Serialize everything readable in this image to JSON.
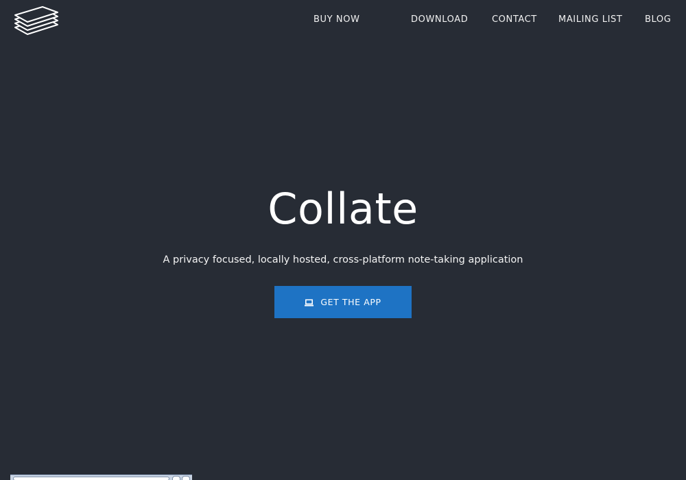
{
  "header": {
    "logo_icon": "stacked-papers-icon",
    "nav": [
      {
        "label": "BUY NOW"
      },
      {
        "label": "DOWNLOAD"
      },
      {
        "label": "CONTACT"
      },
      {
        "label": "MAILING LIST"
      },
      {
        "label": "BLOG"
      }
    ]
  },
  "hero": {
    "title": "Collate",
    "subtitle": "A privacy focused, locally hosted, cross-platform note-taking application",
    "cta_label": "GET THE APP",
    "cta_icon": "laptop-icon"
  },
  "colors": {
    "background": "#272c35",
    "accent": "#1e73c4",
    "text": "#ffffff"
  }
}
